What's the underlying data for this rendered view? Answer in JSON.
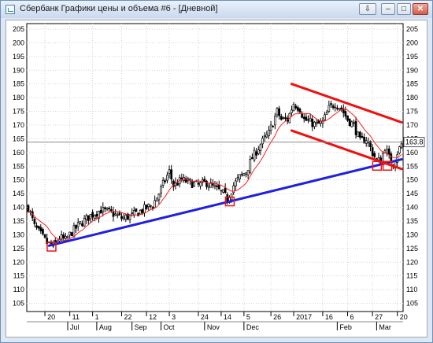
{
  "window": {
    "title": "Сбербанк Графики цены и объема #6 - [Дневной]",
    "pin_icon": "pin-icon",
    "buttons": [
      "minimize-icon",
      "restore-icon",
      "close-icon"
    ]
  },
  "chart_data": {
    "type": "candlestick",
    "y_ticks": [
      105,
      110,
      115,
      120,
      125,
      130,
      135,
      140,
      145,
      150,
      155,
      160,
      165,
      170,
      175,
      180,
      185,
      190,
      195,
      200,
      205
    ],
    "ylim": [
      102,
      207
    ],
    "y_axis_labels_both_sides": true,
    "grid": true,
    "current_price": 163.8,
    "current_price_label": "163.8",
    "x_tick_days": [
      "20",
      "11",
      "1",
      "22",
      "12",
      "3",
      "24",
      "14",
      "5",
      "26",
      "2017",
      "16",
      "6",
      "27",
      "20"
    ],
    "x_month_labels": [
      "Jul",
      "Aug",
      "Sep",
      "Oct",
      "Nov",
      "Dec",
      "Feb",
      "Mar"
    ],
    "price_path": [
      [
        0,
        140
      ],
      [
        3,
        133
      ],
      [
        6,
        130
      ],
      [
        9,
        127
      ],
      [
        12,
        126
      ],
      [
        15,
        129
      ],
      [
        18,
        128
      ],
      [
        21,
        131
      ],
      [
        25,
        134
      ],
      [
        30,
        137
      ],
      [
        35,
        139
      ],
      [
        40,
        138
      ],
      [
        45,
        136
      ],
      [
        50,
        137
      ],
      [
        55,
        139
      ],
      [
        60,
        141
      ],
      [
        63,
        145
      ],
      [
        66,
        150
      ],
      [
        68,
        153
      ],
      [
        70,
        148
      ],
      [
        74,
        150
      ],
      [
        78,
        149
      ],
      [
        82,
        148
      ],
      [
        86,
        149
      ],
      [
        90,
        147
      ],
      [
        94,
        145
      ],
      [
        96,
        143
      ],
      [
        99,
        148
      ],
      [
        102,
        151
      ],
      [
        105,
        153
      ],
      [
        108,
        158
      ],
      [
        112,
        163
      ],
      [
        116,
        167
      ],
      [
        118,
        171
      ],
      [
        120,
        175
      ],
      [
        122,
        172
      ],
      [
        125,
        172
      ],
      [
        128,
        178
      ],
      [
        131,
        176
      ],
      [
        133,
        172
      ],
      [
        136,
        171
      ],
      [
        139,
        170
      ],
      [
        142,
        171
      ],
      [
        145,
        176
      ],
      [
        148,
        178
      ],
      [
        151,
        176
      ],
      [
        154,
        172
      ],
      [
        157,
        170
      ],
      [
        160,
        164
      ],
      [
        163,
        165
      ],
      [
        166,
        160
      ],
      [
        168,
        157
      ],
      [
        170,
        157
      ],
      [
        172,
        162
      ],
      [
        174,
        158
      ],
      [
        176,
        156
      ],
      [
        178,
        160
      ],
      [
        180,
        163
      ]
    ],
    "overlays": [
      {
        "name": "moving_average",
        "color": "#ff2020"
      },
      {
        "name": "support_trendline",
        "color": "#2020dd",
        "from": [
          10,
          126
        ],
        "to": [
          180,
          157.5
        ]
      },
      {
        "name": "channel_upper",
        "color": "#ee1111",
        "from": [
          127,
          185
        ],
        "to": [
          180,
          171
        ]
      },
      {
        "name": "channel_lower",
        "color": "#ee1111",
        "from": [
          127,
          168
        ],
        "to": [
          180,
          154
        ]
      }
    ],
    "highlight_boxes": [
      {
        "x": 11,
        "y": 125.5
      },
      {
        "x": 97,
        "y": 142
      },
      {
        "x": 168,
        "y": 155
      },
      {
        "x": 173,
        "y": 155
      }
    ]
  }
}
